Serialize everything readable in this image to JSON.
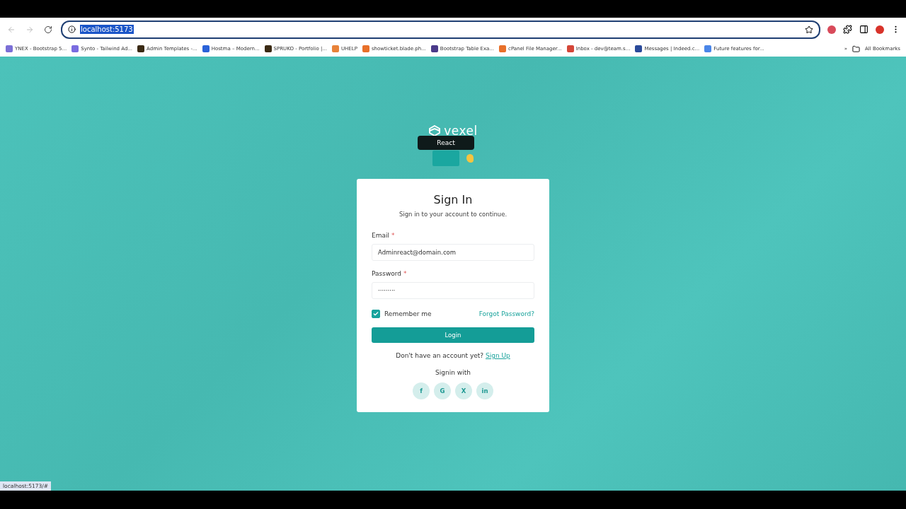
{
  "browser": {
    "url": "localhost:5173",
    "bookmarks": [
      {
        "label": "YNEX - Bootstrap 5...",
        "color": "#7b6fd6"
      },
      {
        "label": "Synto - Tailwind Ad...",
        "color": "#7a6ce0"
      },
      {
        "label": "Admin Templates -...",
        "color": "#3a2a14"
      },
      {
        "label": "Hostma – Modern...",
        "color": "#2a62d8"
      },
      {
        "label": "SPRUKO - Portfolio |...",
        "color": "#3a2a14"
      },
      {
        "label": "UHELP",
        "color": "#e8833a"
      },
      {
        "label": "showticket.blade.ph...",
        "color": "#e8702a"
      },
      {
        "label": "Bootstrap Table Exa...",
        "color": "#4a3a8a"
      },
      {
        "label": "cPanel File Manager...",
        "color": "#e8702a"
      },
      {
        "label": "Inbox - dev@team.s...",
        "color": "#d44638"
      },
      {
        "label": "Messages | Indeed.c...",
        "color": "#2a4a9a"
      },
      {
        "label": "Future features for...",
        "color": "#4a86e8"
      }
    ],
    "overflow": "»",
    "all_bookmarks": "All Bookmarks"
  },
  "brand": {
    "name": "vexel",
    "tooltip": "React"
  },
  "card": {
    "title": "Sign In",
    "subtitle": "Sign in to your account to continue.",
    "fields": [
      {
        "label": "Email",
        "required": "*",
        "value": "Adminreact@domain.com"
      },
      {
        "label": "Password",
        "required": "*",
        "value": "·········"
      }
    ],
    "remember": {
      "label": "Remember me",
      "checked": true
    },
    "forgot": "Forgot Password?",
    "login": "Login",
    "signup_prompt": "Don't have an account yet?",
    "signup_link": "Sign Up",
    "signin_with": "Signin with",
    "socials": [
      "f",
      "G",
      "X",
      "in"
    ]
  },
  "status_url": "localhost:5173/#"
}
